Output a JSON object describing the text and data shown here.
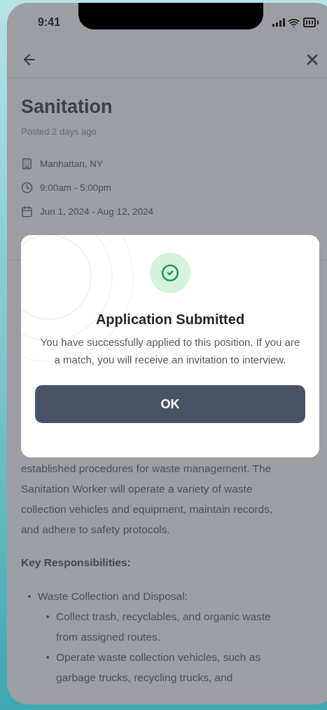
{
  "status_bar": {
    "time": "9:41"
  },
  "job": {
    "title": "Sanitation",
    "posted": "Posted 2 days ago",
    "details": [
      {
        "kind": "location",
        "text": "Manhattan, NY"
      },
      {
        "kind": "hours",
        "text": "9:00am - 5:00pm"
      },
      {
        "kind": "dates",
        "text": "Jun 1, 2024 - Aug 12, 2024"
      }
    ]
  },
  "description": {
    "text": "established procedures for waste management. The Sanitation Worker will operate a variety of waste collection vehicles and equipment, maintain records, and adhere to safety protocols."
  },
  "responsibilities": {
    "heading": "Key Responsibilities:",
    "items": [
      {
        "text": "Waste Collection and Disposal:",
        "children": [
          {
            "text": "Collect trash, recyclables, and organic waste from assigned routes."
          },
          {
            "text": "Operate waste collection vehicles, such as garbage trucks, recycling trucks, and"
          }
        ]
      }
    ]
  },
  "dialog": {
    "title": "Application Submitted",
    "message": "You have successfully applied to this position. If you are a match, you will receive an invitation to interview.",
    "button": "OK"
  }
}
